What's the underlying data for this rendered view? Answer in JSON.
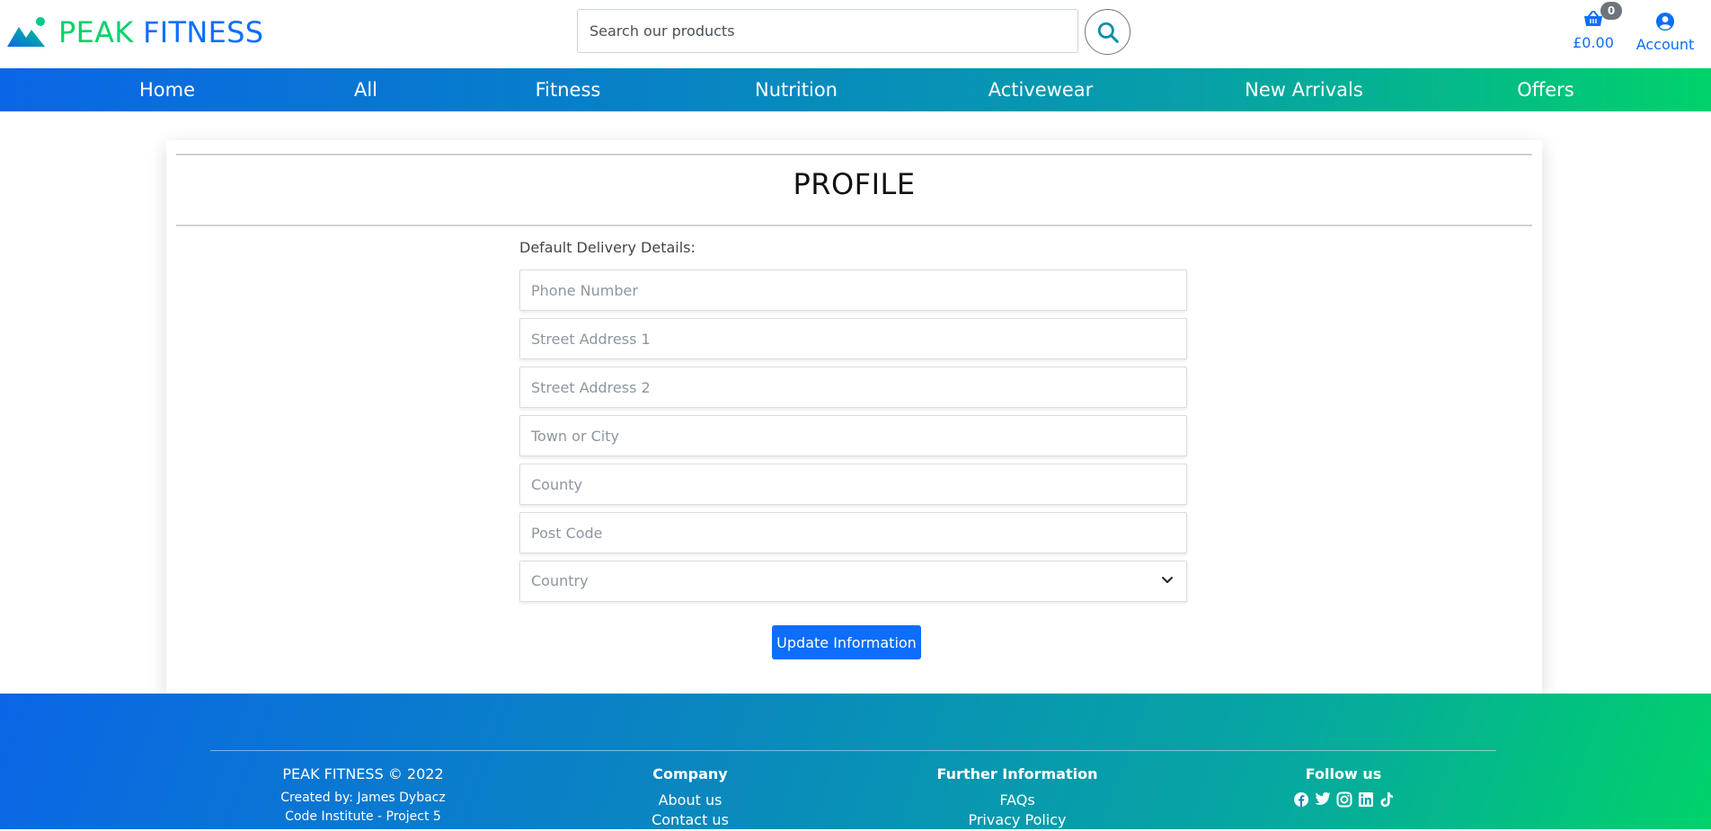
{
  "brand": {
    "name_part1": "PEAK",
    "name_part2": "FITNESS",
    "color_green": "#00d26a",
    "color_blue": "#0d6efd"
  },
  "search": {
    "placeholder": "Search our products"
  },
  "cart": {
    "count": "0",
    "total": "£0.00"
  },
  "account": {
    "label": "Account"
  },
  "nav": {
    "items": [
      "Home",
      "All",
      "Fitness",
      "Nutrition",
      "Activewear",
      "New Arrivals",
      "Offers"
    ]
  },
  "profile": {
    "title": "PROFILE",
    "section_label": "Default Delivery Details:",
    "fields": {
      "phone": "Phone Number",
      "street1": "Street Address 1",
      "street2": "Street Address 2",
      "town": "Town or City",
      "county": "County",
      "postcode": "Post Code",
      "country": "Country"
    },
    "submit_label": "Update Information"
  },
  "footer": {
    "brand_line": "PEAK FITNESS © 2022",
    "created_by": "Created by: James Dybacz",
    "project": "Code Institute - Project 5",
    "company": {
      "heading": "Company",
      "links": [
        "About us",
        "Contact us"
      ]
    },
    "further": {
      "heading": "Further Information",
      "links": [
        "FAQs",
        "Privacy Policy"
      ]
    },
    "follow": {
      "heading": "Follow us",
      "icons": [
        "facebook-icon",
        "twitter-icon",
        "instagram-icon",
        "linkedin-icon",
        "tiktok-icon"
      ]
    }
  }
}
